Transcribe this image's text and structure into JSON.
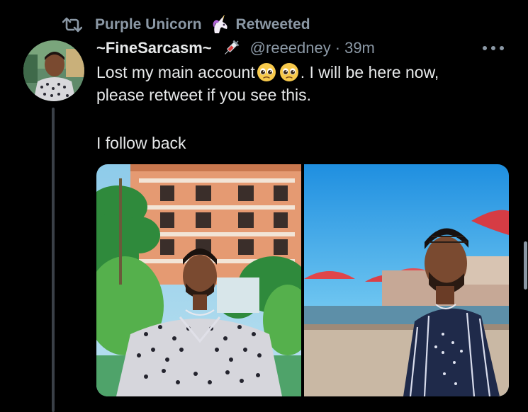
{
  "retweet": {
    "icon": "retweet-icon",
    "retweeter_name": "Purple Unicorn",
    "badge_emoji": "unicorn-icon",
    "label": "Retweeted"
  },
  "tweet": {
    "display_name": "~FineSarcasm~",
    "name_emoji": "syringe-icon",
    "handle": "@reeedney",
    "separator": "·",
    "time": "39m",
    "text_part1": "Lost my main account",
    "emojis": [
      "pleading-face-icon",
      "pleading-face-icon"
    ],
    "text_part2": ". I will be here now,",
    "text_line2": "please retweet if you see this.",
    "text_line3": "I follow back",
    "more_icon": "more-icon"
  },
  "media": {
    "count": 2,
    "photos": [
      "left-photo",
      "right-photo"
    ]
  },
  "colors": {
    "background": "#000000",
    "primary_text": "#e7e9ea",
    "secondary_text": "#8b98a5",
    "thread_line": "#3a4047"
  }
}
